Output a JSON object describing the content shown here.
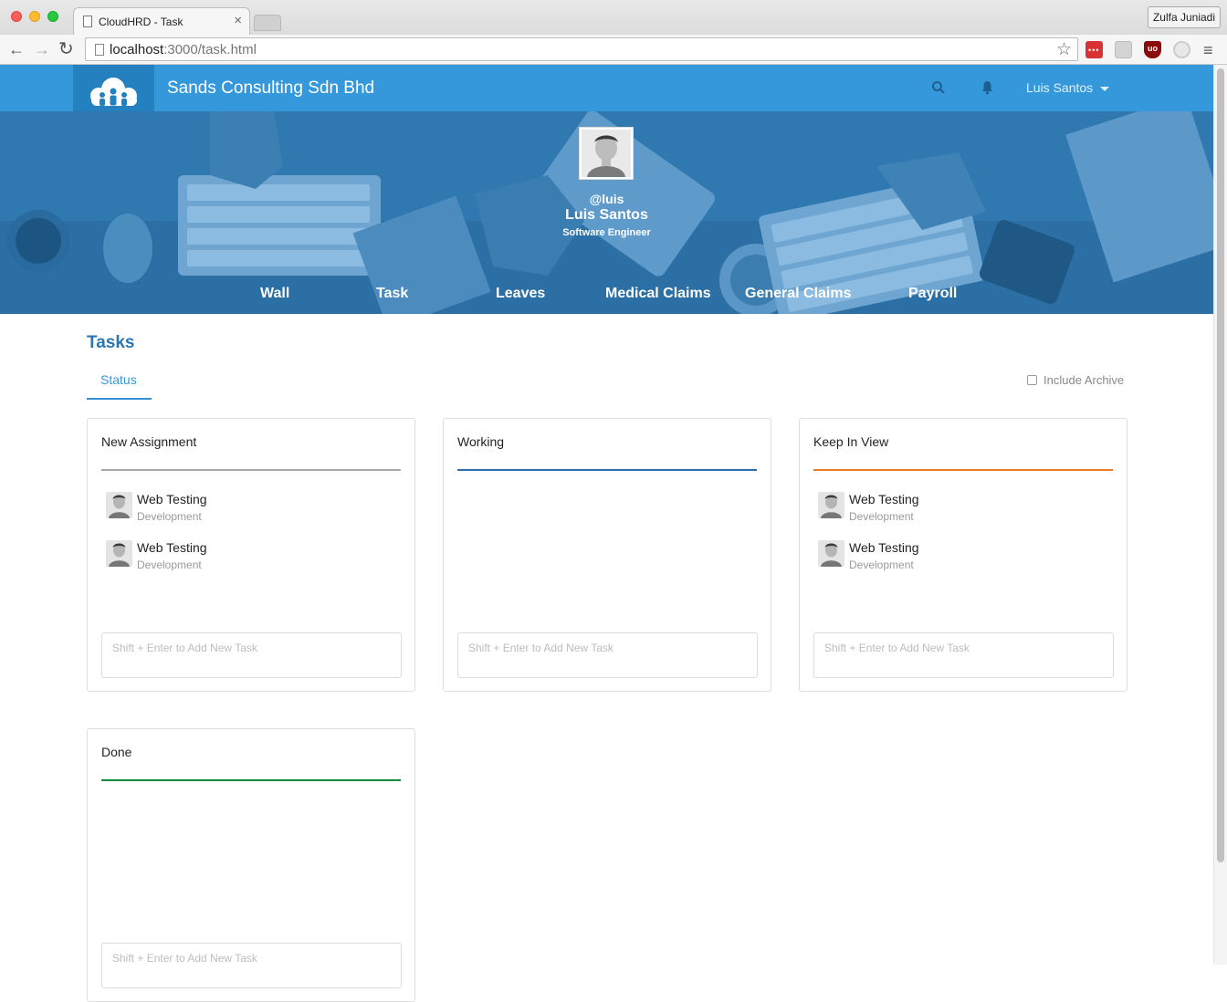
{
  "browser": {
    "tab_title": "CloudHRD - Task",
    "tab_close": "×",
    "profile_name": "Zulfa Juniadi",
    "url_host": "localhost",
    "url_path": ":3000/task.html",
    "back": "←",
    "forward": "→",
    "reload": "↻",
    "star": "☆",
    "menu": "≡",
    "extensions": [
      "lastpass-icon",
      "css-viewer-icon",
      "ublock-icon",
      "sync-icon"
    ],
    "ext_labels": {
      "lastpass": "•••",
      "ublock": "uo"
    }
  },
  "app": {
    "company_name": "Sands Consulting Sdn Bhd",
    "user_menu": "Luis Santos",
    "icons": [
      "cloud-logo-icon",
      "search-icon",
      "bell-icon"
    ]
  },
  "profile": {
    "handle": "@luis",
    "name": "Luis Santos",
    "title": "Software Engineer"
  },
  "nav": [
    "Wall",
    "Task",
    "Leaves",
    "Medical Claims",
    "General Claims",
    "Payroll"
  ],
  "page": {
    "title": "Tasks",
    "tab": "Status",
    "include_archive": "Include Archive",
    "include_archive_checked": false
  },
  "columns": [
    {
      "title": "New Assignment",
      "accent": "#a7a7a7",
      "placeholder": "Shift + Enter to Add New Task",
      "tasks": [
        {
          "name": "Web Testing",
          "dept": "Development"
        },
        {
          "name": "Web Testing",
          "dept": "Development"
        }
      ]
    },
    {
      "title": "Working",
      "accent": "#2a6fab",
      "placeholder": "Shift + Enter to Add New Task",
      "tasks": []
    },
    {
      "title": "Keep In View",
      "accent": "#ec7b22",
      "placeholder": "Shift + Enter to Add New Task",
      "tasks": [
        {
          "name": "Web Testing",
          "dept": "Development"
        },
        {
          "name": "Web Testing",
          "dept": "Development"
        }
      ]
    },
    {
      "title": "Done",
      "accent": "#168a3c",
      "placeholder": "Shift + Enter to Add New Task",
      "tasks": []
    }
  ],
  "colors": {
    "appbar": "#3598db",
    "logo_bg": "#2580bf",
    "banner": "#2f78b0",
    "title_blue": "#2b76ae"
  }
}
